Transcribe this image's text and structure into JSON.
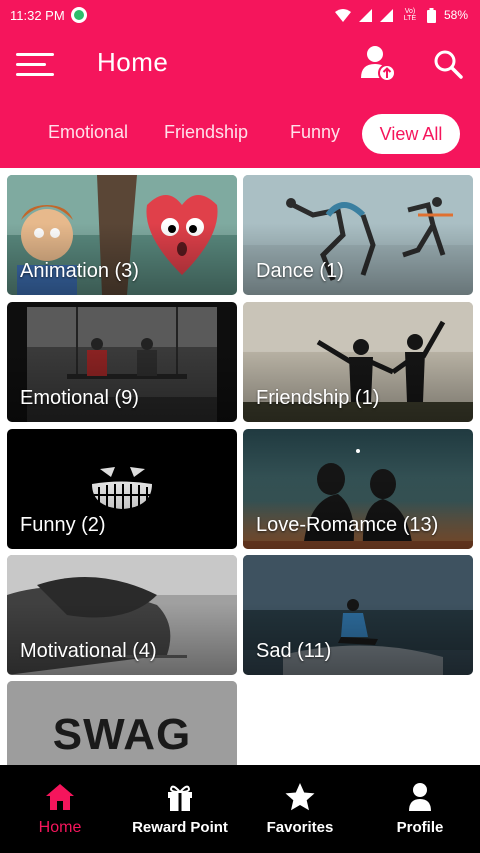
{
  "status_bar": {
    "time": "11:32 PM",
    "network_label": "Vo) LTE",
    "battery": "58%"
  },
  "header": {
    "title": "Home"
  },
  "tabs": [
    "Emotional",
    "Friendship",
    "Funny"
  ],
  "view_all_label": "View All",
  "categories": [
    {
      "label": "Animation (3)"
    },
    {
      "label": "Dance (1)"
    },
    {
      "label": "Emotional (9)"
    },
    {
      "label": "Friendship (1)"
    },
    {
      "label": "Funny (2)"
    },
    {
      "label": "Love-Romamce (13)"
    },
    {
      "label": "Motivational (4)"
    },
    {
      "label": "Sad (11)"
    },
    {
      "label": ""
    }
  ],
  "swag_text": "SWAG",
  "bottom_nav": [
    {
      "label": "Home",
      "icon": "home-icon",
      "active": true
    },
    {
      "label": "Reward Point",
      "icon": "gift-icon",
      "active": false
    },
    {
      "label": "Favorites",
      "icon": "star-icon",
      "active": false
    },
    {
      "label": "Profile",
      "icon": "person-icon",
      "active": false
    }
  ],
  "colors": {
    "accent": "#f5155c",
    "nav_bg": "#000000",
    "tab_inactive": "#ffe0ea"
  }
}
